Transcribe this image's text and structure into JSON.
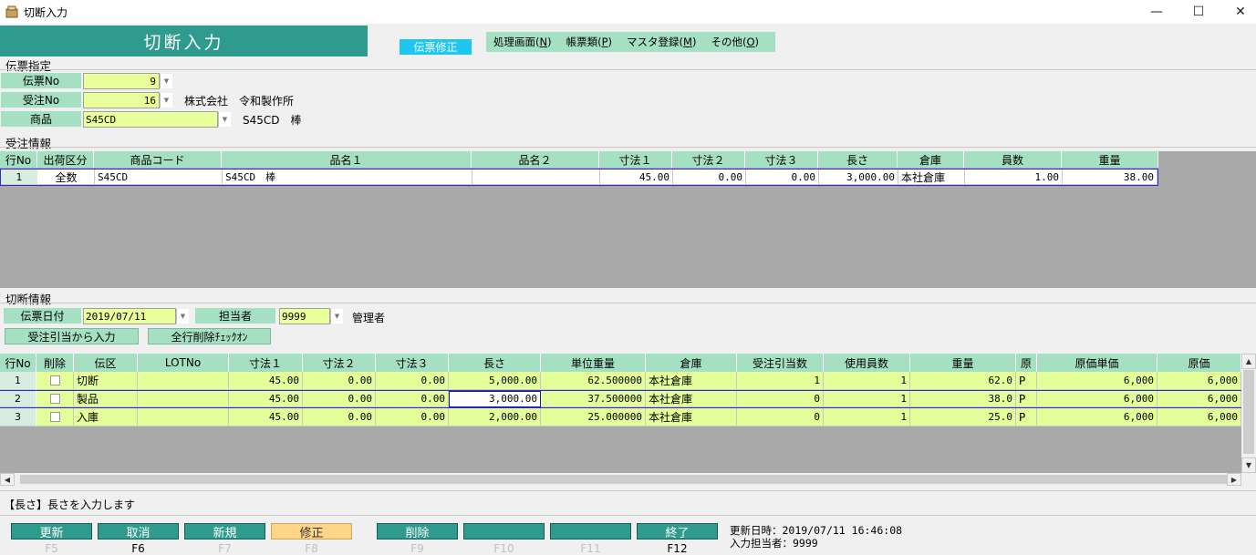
{
  "window": {
    "title": "切断入力",
    "minimize": "—",
    "maximize": "☐",
    "close": "✕"
  },
  "header": {
    "app_title": "切断入力",
    "mode": "伝票修正"
  },
  "menu": [
    {
      "label": "処理画面(N)"
    },
    {
      "label": "帳票類(P)"
    },
    {
      "label": "マスタ登録(M)"
    },
    {
      "label": "その他(O)"
    }
  ],
  "slip_spec": {
    "section": "伝票指定",
    "slip_no_label": "伝票No",
    "slip_no": "9",
    "order_no_label": "受注No",
    "order_no": "16",
    "customer": "株式会社　令和製作所",
    "product_label": "商品",
    "product_code": "S45CD",
    "product_name": "S45CD　棒"
  },
  "order_info": {
    "section": "受注情報",
    "columns": [
      "行No",
      "出荷区分",
      "商品コード",
      "品名１",
      "品名２",
      "寸法１",
      "寸法２",
      "寸法３",
      "長さ",
      "倉庫",
      "員数",
      "重量"
    ],
    "rows": [
      [
        "1",
        "全数",
        "S45CD",
        "S45CD　棒",
        "",
        "45.00",
        "0.00",
        "0.00",
        "3,000.00",
        "本社倉庫",
        "1.00",
        "38.00"
      ]
    ]
  },
  "cut_info": {
    "section": "切断情報",
    "date_label": "伝票日付",
    "date": "2019/07/11",
    "staff_label": "担当者",
    "staff_code": "9999",
    "staff_name": "管理者",
    "btn_from_order": "受注引当から入力",
    "btn_delete_check": "全行削除ﾁｪｯｸｵﾝ",
    "columns": [
      "行No",
      "削除",
      "伝区",
      "LOTNo",
      "寸法１",
      "寸法２",
      "寸法３",
      "長さ",
      "単位重量",
      "倉庫",
      "受注引当数",
      "使用員数",
      "重量",
      "原",
      "原価単価",
      "原価"
    ],
    "rows": [
      [
        "1",
        "",
        "切断",
        "",
        "45.00",
        "0.00",
        "0.00",
        "5,000.00",
        "62.500000",
        "本社倉庫",
        "1",
        "1",
        "62.0",
        "P",
        "6,000",
        "6,000"
      ],
      [
        "2",
        "",
        "製品",
        "",
        "45.00",
        "0.00",
        "0.00",
        "3,000.00",
        "37.500000",
        "本社倉庫",
        "0",
        "1",
        "38.0",
        "P",
        "6,000",
        "6,000"
      ],
      [
        "3",
        "",
        "入庫",
        "",
        "45.00",
        "0.00",
        "0.00",
        "2,000.00",
        "25.000000",
        "本社倉庫",
        "0",
        "1",
        "25.0",
        "P",
        "6,000",
        "6,000"
      ]
    ]
  },
  "status": {
    "message": "【長さ】長さを入力します"
  },
  "fkeys": [
    {
      "label": "更新",
      "key": "F5",
      "active": false,
      "dim": true
    },
    {
      "label": "取消",
      "key": "F6",
      "active": false,
      "dim": false
    },
    {
      "label": "新規",
      "key": "F7",
      "active": false,
      "dim": true
    },
    {
      "label": "修正",
      "key": "F8",
      "active": true,
      "dim": true
    },
    {
      "label": "削除",
      "key": "F9",
      "active": false,
      "dim": true
    },
    {
      "label": "",
      "key": "F10",
      "active": false,
      "dim": true
    },
    {
      "label": "",
      "key": "F11",
      "active": false,
      "dim": true
    },
    {
      "label": "終了",
      "key": "F12",
      "active": false,
      "dim": false
    }
  ],
  "footer": {
    "updated": "更新日時：2019/07/11 16:46:08",
    "entered_by": "入力担当者：9999"
  },
  "colors": {
    "accent": "#2f9a8e",
    "label_bg": "#a6e0c2",
    "field_bg": "#e9ff9a",
    "mode_badge": "#1ec6f0"
  }
}
